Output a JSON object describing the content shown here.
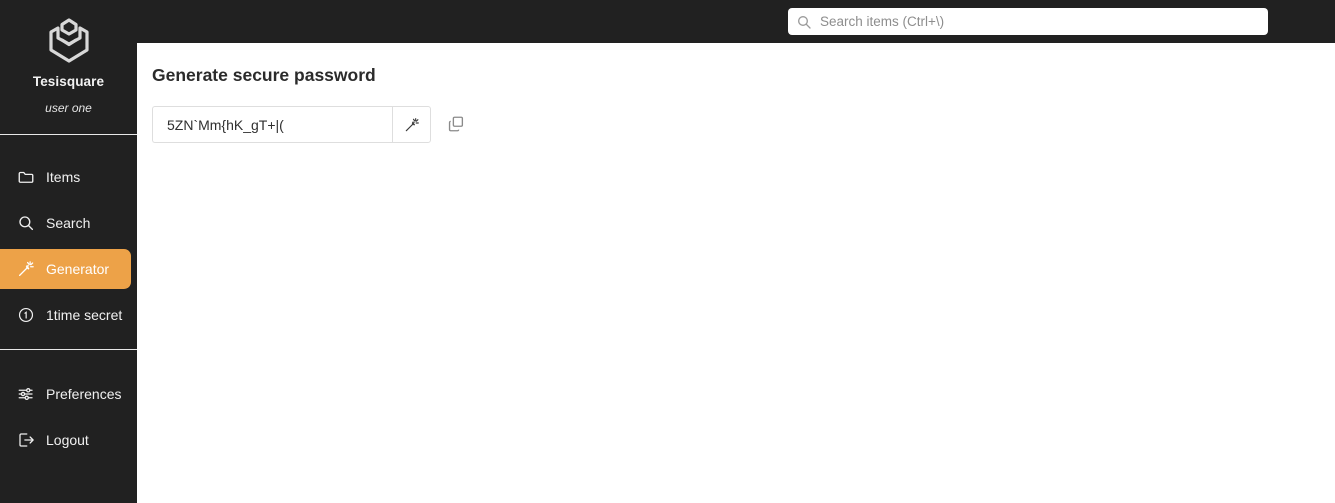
{
  "brand": {
    "logo_icon": "shield-chevron-logo",
    "name": "Tesisquare",
    "user": "user one"
  },
  "search": {
    "icon": "search-icon",
    "placeholder": "Search items (Ctrl+\\)",
    "value": ""
  },
  "sidebar": {
    "items": [
      {
        "label": "Items",
        "icon": "folder-icon",
        "active": false
      },
      {
        "label": "Search",
        "icon": "search-icon",
        "active": false
      },
      {
        "label": "Generator",
        "icon": "magic-wand-icon",
        "active": true
      },
      {
        "label": "1time secret",
        "icon": "circle-one-icon",
        "active": false
      }
    ],
    "bottom_items": [
      {
        "label": "Preferences",
        "icon": "sliders-icon"
      },
      {
        "label": "Logout",
        "icon": "logout-icon"
      }
    ]
  },
  "main": {
    "title": "Generate secure password",
    "password": {
      "value": "5ZN`Mm{hK_gT+|(",
      "placeholder": ""
    },
    "generate_button_icon": "magic-wand-icon",
    "copy_button_icon": "copy-icon"
  },
  "colors": {
    "sidebar_bg": "#212121",
    "header_bg": "#212121",
    "accent": "#eda248",
    "content_bg": "#ffffff",
    "text_light": "#f0f0f0",
    "text_dark": "#2b2b2b"
  }
}
